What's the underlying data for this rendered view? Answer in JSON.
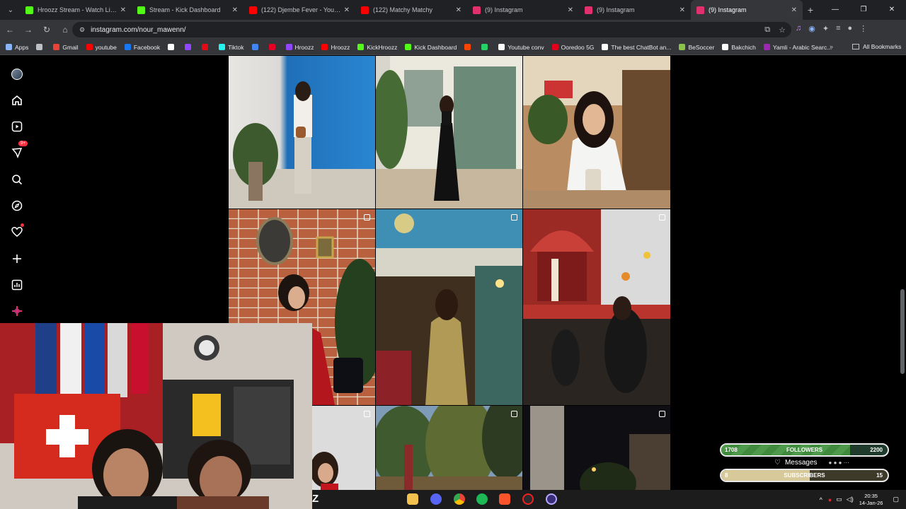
{
  "browser": {
    "tabs": [
      {
        "title": "Hroozz Stream - Watch Live on",
        "icon": "kick-icon",
        "color": "#53fc18",
        "active": false
      },
      {
        "title": "Stream - Kick Dashboard",
        "icon": "kick-icon",
        "color": "#53fc18",
        "active": false
      },
      {
        "title": "(122) Djembe Fever - YouTu",
        "icon": "youtube-icon",
        "color": "#ff0000",
        "active": false
      },
      {
        "title": "(122) Matchy Matchy",
        "icon": "youtube-icon",
        "color": "#ff0000",
        "active": false
      },
      {
        "title": "(9) Instagram",
        "icon": "instagram-icon",
        "color": "#e1306c",
        "active": false
      },
      {
        "title": "(9) Instagram",
        "icon": "instagram-icon",
        "color": "#e1306c",
        "active": false
      },
      {
        "title": "(9) Instagram",
        "icon": "instagram-icon",
        "color": "#e1306c",
        "active": true
      }
    ],
    "url": "instagram.com/nour_mawenn/",
    "bookmarks": [
      {
        "label": "Apps",
        "color": "#8ab4f8"
      },
      {
        "label": "",
        "color": "#bdc1c6"
      },
      {
        "label": "Gmail",
        "color": "#ea4335"
      },
      {
        "label": "youtube",
        "color": "#ff0000"
      },
      {
        "label": "Facebook",
        "color": "#1877f2"
      },
      {
        "label": "",
        "color": "#ffffff"
      },
      {
        "label": "",
        "color": "#9146ff"
      },
      {
        "label": "",
        "color": "#e50914"
      },
      {
        "label": "Tiktok",
        "color": "#25f4ee"
      },
      {
        "label": "",
        "color": "#4285f4"
      },
      {
        "label": "",
        "color": "#e60023"
      },
      {
        "label": "Hroozz",
        "color": "#9146ff"
      },
      {
        "label": "Hroozz",
        "color": "#ff0000"
      },
      {
        "label": "KickHroozz",
        "color": "#53fc18"
      },
      {
        "label": "Kick Dashboard",
        "color": "#53fc18"
      },
      {
        "label": "",
        "color": "#ff4500"
      },
      {
        "label": "",
        "color": "#25d366"
      },
      {
        "label": "Youtube conv",
        "color": "#ffffff"
      },
      {
        "label": "Ooredoo 5G",
        "color": "#e2001a"
      },
      {
        "label": "The best ChatBot an...",
        "color": "#ffffff"
      },
      {
        "label": "BeSoccer",
        "color": "#8bc34a"
      },
      {
        "label": "Bakchich",
        "color": "#ffffff"
      },
      {
        "label": "Yamli - Arabic Searc...",
        "color": "#9c27b0"
      }
    ],
    "all_bookmarks": "All Bookmarks"
  },
  "instagram": {
    "notification_count": "9+",
    "sidebar_icons": [
      "profile-avatar-icon",
      "home-icon",
      "reels-icon",
      "messages-icon",
      "search-icon",
      "explore-icon",
      "notifications-icon",
      "create-icon",
      "dashboard-icon",
      "meta-ai-icon"
    ]
  },
  "stream_widgets": {
    "followers": {
      "current": "1708",
      "label": "FOLLOWERS",
      "goal": "2200",
      "progress": 0.776
    },
    "messages_label": "Messages",
    "subscribers": {
      "current": "8",
      "label": "SUBSCRIBERS",
      "goal": "15",
      "progress": 0.533
    }
  },
  "taskbar": {
    "time": "20:35",
    "date": "14-Jan-26"
  }
}
